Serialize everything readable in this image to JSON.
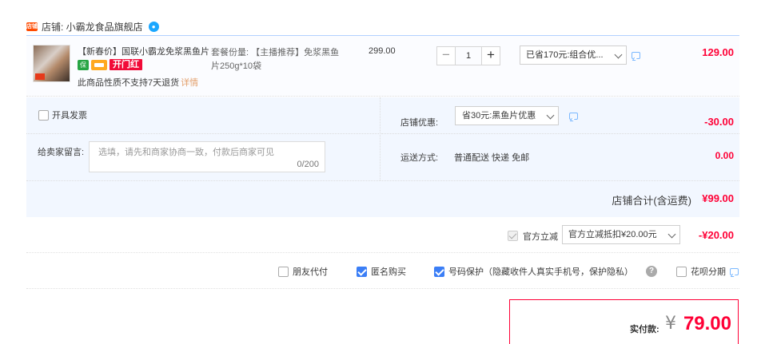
{
  "shop": {
    "icon_text": "店铺",
    "label": "店铺: 小霸龙食品旗舰店",
    "wangwang_icon": "chat-bubble-icon"
  },
  "item": {
    "title": "【新春价】国联小霸龙免浆黑鱼片",
    "badge_green": "保",
    "badge_red": "开门红",
    "return_note": "此商品性质不支持7天退货",
    "return_detail": "详情",
    "spec": "套餐份量: 【主播推荐】免浆黑鱼片250g*10袋",
    "unit_price": "299.00",
    "qty_minus": "−",
    "qty_value": "1",
    "qty_plus": "+",
    "promo": "已省170元:组合优...",
    "total": "129.00"
  },
  "invoice": {
    "label": "开具发票"
  },
  "memo": {
    "label": "给卖家留言:",
    "placeholder": "选填，请先和商家协商一致，付款后商家可见",
    "count": "0/200"
  },
  "discount": {
    "label": "店铺优惠:",
    "value_select": "省30元:黑鱼片优惠",
    "amount": "-30.00"
  },
  "shipping": {
    "label": "运送方式:",
    "method": "普通配送 快递 免邮",
    "amount": "0.00"
  },
  "shop_total": {
    "label": "店铺合计(含运费)",
    "amount": "¥99.00"
  },
  "official": {
    "label": "官方立减",
    "select": "官方立减抵扣¥20.00元",
    "amount": "-¥20.00"
  },
  "options": {
    "friend_pay": "朋友代付",
    "anonymous": "匿名购买",
    "number_protect": "号码保护（隐藏收件人真实手机号，保护隐私）",
    "help": "?",
    "installment": "花呗分期"
  },
  "payment": {
    "label": "实付款:",
    "currency": "¥",
    "amount": "79.00"
  },
  "colors": {
    "price_red": "#ff0036",
    "accent_blue": "#3b7ef6",
    "panel_bg": "#f2f7ff"
  }
}
